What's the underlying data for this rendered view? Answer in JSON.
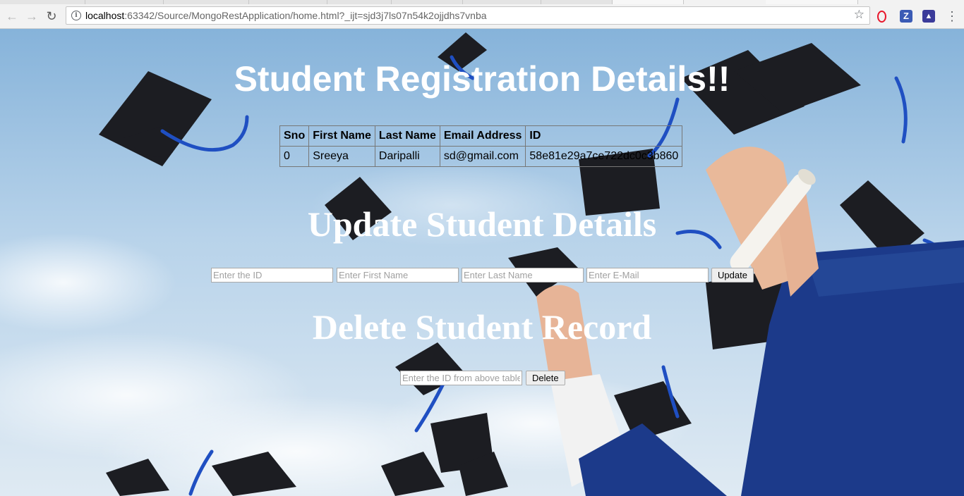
{
  "browser": {
    "url_host": "localhost",
    "url_rest": ":63342/Source/MongoRestApplication/home.html?_ijt=sjd3j7ls07n54k2ojjdhs7vnba",
    "icons": [
      "back-icon",
      "forward-icon",
      "reload-icon",
      "info-icon",
      "star-icon",
      "opera-icon",
      "z-extension-icon",
      "extension-icon",
      "menu-icon"
    ],
    "ext_z_label": "Z"
  },
  "page": {
    "title": "Student Registration Details!!",
    "table": {
      "headers": [
        "Sno",
        "First Name",
        "Last Name",
        "Email Address",
        "ID"
      ],
      "rows": [
        [
          "0",
          "Sreeya",
          "Daripalli",
          "sd@gmail.com",
          "58e81e29a7ce722dc0c3b860"
        ]
      ]
    },
    "update": {
      "heading": "Update Student Details",
      "id_placeholder": "Enter the ID",
      "first_placeholder": "Enter First Name",
      "last_placeholder": "Enter Last Name",
      "email_placeholder": "Enter E-Mail",
      "button_label": "Update"
    },
    "delete": {
      "heading": "Delete Student Record",
      "id_placeholder": "Enter the ID from above table",
      "button_label": "Delete"
    }
  },
  "colors": {
    "sky": "#a9cbe6",
    "cap": "#1b1d22",
    "tassel": "#1f4fc2",
    "gown": "#1c3a8a",
    "heading": "#ffffff"
  }
}
